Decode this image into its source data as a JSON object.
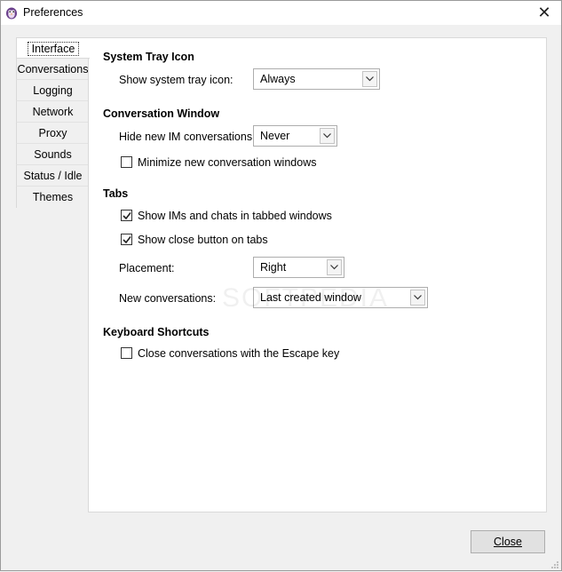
{
  "window": {
    "title": "Preferences",
    "close_symbol": "✕"
  },
  "tabs": [
    {
      "label": "Interface",
      "active": true
    },
    {
      "label": "Conversations"
    },
    {
      "label": "Logging"
    },
    {
      "label": "Network"
    },
    {
      "label": "Proxy"
    },
    {
      "label": "Sounds"
    },
    {
      "label": "Status / Idle"
    },
    {
      "label": "Themes"
    }
  ],
  "system_tray": {
    "heading": "System Tray Icon",
    "show_label": "Show system tray icon:",
    "show_value": "Always"
  },
  "conversation_window": {
    "heading": "Conversation Window",
    "hide_label": "Hide new IM conversations:",
    "hide_value": "Never",
    "minimize_label": "Minimize new conversation windows",
    "minimize_checked": false
  },
  "tabs_section": {
    "heading": "Tabs",
    "tabbed_label": "Show IMs and chats in tabbed windows",
    "tabbed_checked": true,
    "close_btn_label": "Show close button on tabs",
    "close_btn_checked": true,
    "placement_label": "Placement:",
    "placement_value": "Right",
    "new_conv_label": "New conversations:",
    "new_conv_value": "Last created window"
  },
  "keyboard": {
    "heading": "Keyboard Shortcuts",
    "escape_label": "Close conversations with the Escape key",
    "escape_checked": false
  },
  "footer": {
    "close_label": "Close"
  },
  "watermark": "SOFTPEDIA"
}
